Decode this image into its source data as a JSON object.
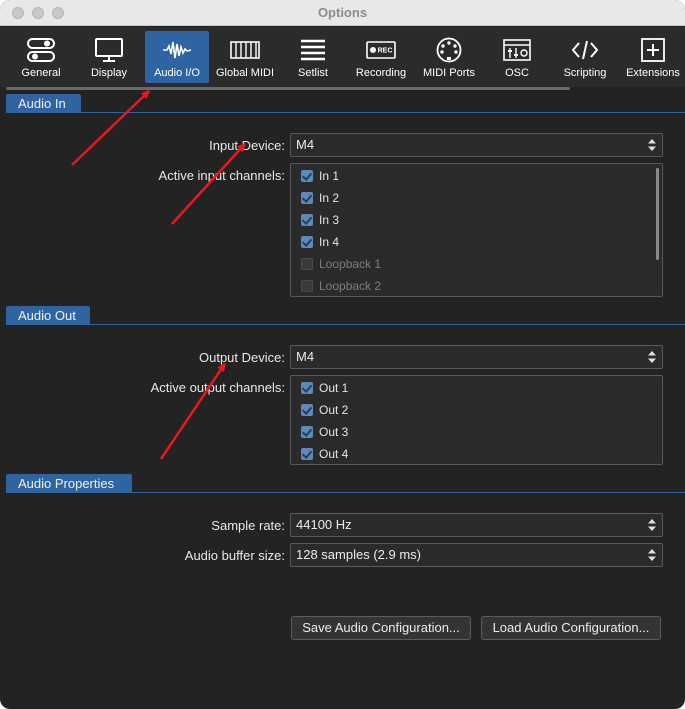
{
  "window": {
    "title": "Options"
  },
  "toolbar": {
    "items": [
      {
        "label": "General",
        "icon": "toggles-icon"
      },
      {
        "label": "Display",
        "icon": "monitor-icon"
      },
      {
        "label": "Audio I/O",
        "icon": "waveform-icon",
        "active": true
      },
      {
        "label": "Global MIDI",
        "icon": "keyboard-icon"
      },
      {
        "label": "Setlist",
        "icon": "list-icon"
      },
      {
        "label": "Recording",
        "icon": "record-icon"
      },
      {
        "label": "MIDI Ports",
        "icon": "midi-port-icon"
      },
      {
        "label": "OSC",
        "icon": "osc-icon"
      },
      {
        "label": "Scripting",
        "icon": "code-icon"
      },
      {
        "label": "Extensions",
        "icon": "plus-box-icon"
      }
    ],
    "rec_badge": "REC"
  },
  "audio_in": {
    "section_title": "Audio In",
    "input_device_label": "Input Device:",
    "input_device_value": "M4",
    "channels_label": "Active input channels:",
    "channels": [
      {
        "name": "In 1",
        "checked": true
      },
      {
        "name": "In 2",
        "checked": true
      },
      {
        "name": "In 3",
        "checked": true
      },
      {
        "name": "In 4",
        "checked": true
      },
      {
        "name": "Loopback 1",
        "checked": false
      },
      {
        "name": "Loopback 2",
        "checked": false
      }
    ]
  },
  "audio_out": {
    "section_title": "Audio Out",
    "output_device_label": "Output Device:",
    "output_device_value": "M4",
    "channels_label": "Active output channels:",
    "channels": [
      {
        "name": "Out 1",
        "checked": true
      },
      {
        "name": "Out 2",
        "checked": true
      },
      {
        "name": "Out 3",
        "checked": true
      },
      {
        "name": "Out 4",
        "checked": true
      }
    ]
  },
  "audio_properties": {
    "section_title": "Audio Properties",
    "sample_rate_label": "Sample rate:",
    "sample_rate_value": "44100 Hz",
    "buffer_size_label": "Audio buffer size:",
    "buffer_size_value": "128 samples (2.9 ms)"
  },
  "buttons": {
    "save": "Save Audio Configuration...",
    "load": "Load Audio Configuration..."
  },
  "colors": {
    "accent": "#2f64a3",
    "background": "#232323",
    "annotation_arrow": "#e8191b"
  }
}
